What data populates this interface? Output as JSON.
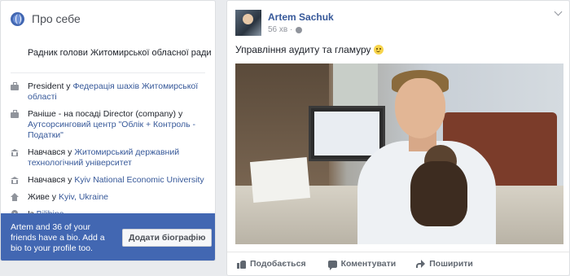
{
  "about": {
    "title": "Про себе",
    "role": "Радник голови Житомирської обласної ради",
    "items": [
      {
        "icon": "briefcase-icon",
        "pre": "President у ",
        "link": "Федерація шахів Житомирської області"
      },
      {
        "icon": "briefcase-icon",
        "pre": "Раніше - на посаді Director (company) у ",
        "link": "Аутсорсинговий центр \"Облік + Контроль - Податки\""
      },
      {
        "icon": "school-icon",
        "pre": "Навчався у ",
        "link": "Житомирський державний технологічний університет"
      },
      {
        "icon": "school-icon",
        "pre": "Навчався у ",
        "link": "Kyiv National Economic University"
      },
      {
        "icon": "home-icon",
        "pre": "Живе у ",
        "link": "Kyiv, Ukraine"
      },
      {
        "icon": "location-pin-icon",
        "pre": "Із ",
        "link": "Bilibino"
      }
    ],
    "bio": {
      "text": "Artem and 36 of your friends have a bio. Add a bio to your profile too.",
      "button": "Додати біографію"
    }
  },
  "post": {
    "author": "Artem Sachuk",
    "time": "56 хв ·",
    "text": "Управління аудиту та гламуру",
    "actions": {
      "like": "Подобається",
      "comment": "Коментувати",
      "share": "Поширити"
    }
  },
  "colors": {
    "link": "#365899",
    "brand": "#4267b2",
    "background": "#e9ebee"
  }
}
